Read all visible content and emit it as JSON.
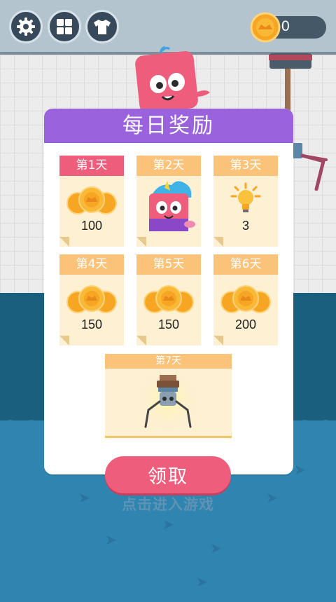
{
  "hud": {
    "coin_count": "0",
    "buttons": [
      {
        "icon": "gear-icon"
      },
      {
        "icon": "grid-icon"
      },
      {
        "icon": "shirt-icon"
      }
    ]
  },
  "daily_reward": {
    "title": "每日奖励",
    "days": [
      {
        "label": "第1天",
        "reward": "coins",
        "amount": "100",
        "today": true
      },
      {
        "label": "第2天",
        "reward": "character-skin",
        "amount": ""
      },
      {
        "label": "第3天",
        "reward": "hint-bulb",
        "amount": "3"
      },
      {
        "label": "第4天",
        "reward": "coins",
        "amount": "150"
      },
      {
        "label": "第5天",
        "reward": "coins",
        "amount": "150"
      },
      {
        "label": "第6天",
        "reward": "coins",
        "amount": "200"
      },
      {
        "label": "第7天",
        "reward": "claw-machine"
      }
    ],
    "claim_label": "领取"
  },
  "hint_text": "点击进入游戏",
  "colors": {
    "header_purple": "#9a63dd",
    "accent_pink": "#ef5d7c",
    "card_bg": "#fdf0d3",
    "day_label": "#fbc37a"
  }
}
